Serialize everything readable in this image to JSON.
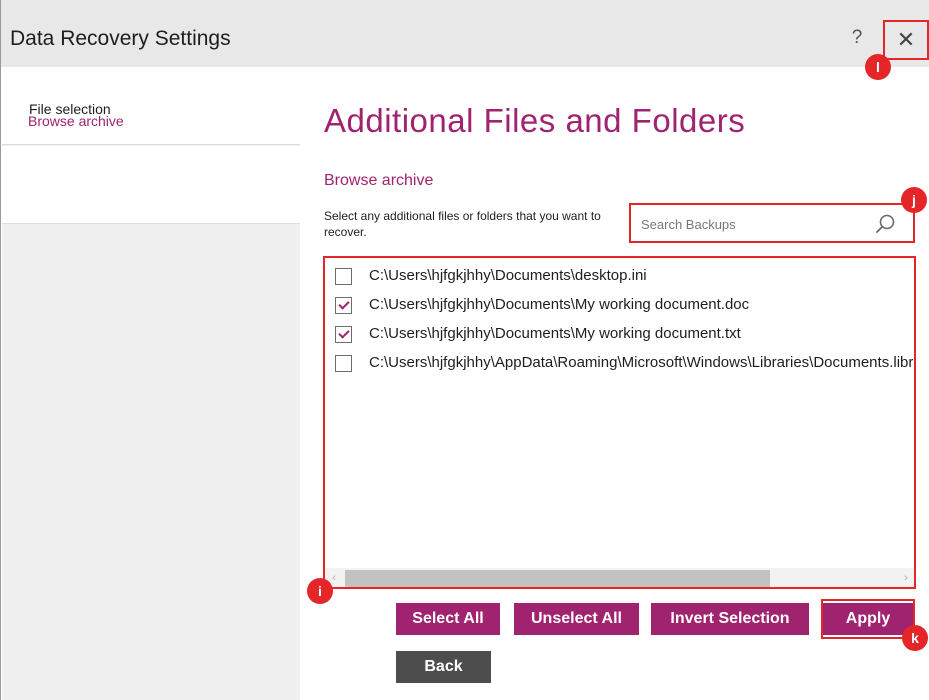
{
  "window": {
    "title": "Data Recovery Settings",
    "help_label": "?",
    "close_label": "✕"
  },
  "sidebar": {
    "items": [
      {
        "label": "File selection"
      },
      {
        "label": "Browse archive"
      }
    ]
  },
  "main": {
    "heading": "Additional Files and Folders",
    "subheading": "Browse archive",
    "instructions": "Select any additional files or folders that you want to recover.",
    "search": {
      "placeholder": "Search Backups",
      "value": "",
      "icon": "search-icon"
    },
    "files": [
      {
        "path": "C:\\Users\\hjfgkjhhy\\Documents\\desktop.ini",
        "checked": false
      },
      {
        "path": "C:\\Users\\hjfgkjhhy\\Documents\\My working document.doc",
        "checked": true
      },
      {
        "path": "C:\\Users\\hjfgkjhhy\\Documents\\My working document.txt",
        "checked": true
      },
      {
        "path": "C:\\Users\\hjfgkjhhy\\AppData\\Roaming\\Microsoft\\Windows\\Libraries\\Documents.library-ms",
        "checked": false
      }
    ],
    "scroll": {
      "left_arrow": "‹",
      "right_arrow": "›"
    }
  },
  "buttons": {
    "select_all": "Select All",
    "unselect_all": "Unselect All",
    "invert_selection": "Invert Selection",
    "apply": "Apply",
    "back": "Back"
  },
  "markers": {
    "l": "l",
    "j": "j",
    "i": "i",
    "k": "k"
  },
  "colors": {
    "accent": "#a0236f",
    "highlight": "#e52629",
    "back_button": "#4d4d4d"
  }
}
